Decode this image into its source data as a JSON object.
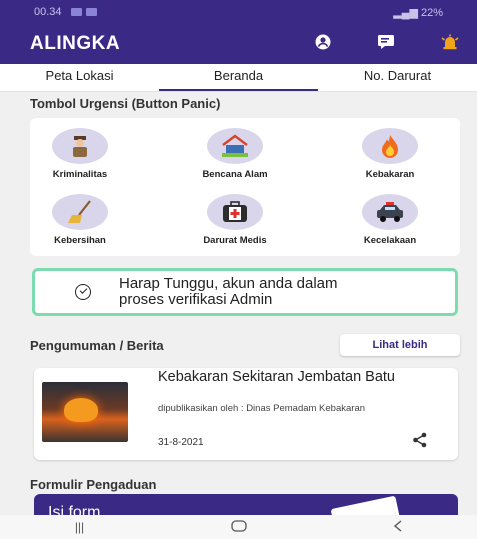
{
  "status_bar": {
    "time": "00.34",
    "battery": "22%"
  },
  "app": {
    "title": "ALINGKA"
  },
  "tabs": [
    {
      "label": "Peta Lokasi"
    },
    {
      "label": "Beranda"
    },
    {
      "label": "No. Darurat"
    }
  ],
  "active_tab": "Beranda",
  "panic": {
    "title": "Tombol Urgensi (Button Panic)",
    "items": [
      {
        "label": "Kriminalitas",
        "icon": "police-officer-icon"
      },
      {
        "label": "Bencana Alam",
        "icon": "disaster-house-icon"
      },
      {
        "label": "Kebakaran",
        "icon": "fire-icon"
      },
      {
        "label": "Kebersihan",
        "icon": "broom-icon"
      },
      {
        "label": "Darurat Medis",
        "icon": "medical-kit-icon"
      },
      {
        "label": "Kecelakaan",
        "icon": "police-car-icon"
      }
    ]
  },
  "verification": {
    "message_line1": "Harap Tunggu, akun anda dalam",
    "message_line2": "proses verifikasi Admin"
  },
  "news": {
    "section_title": "Pengumuman / Berita",
    "more_label": "Lihat lebih",
    "item": {
      "title": "Kebakaran Sekitaran Jembatan Batu",
      "published_by": "dipublikasikan oleh : Dinas Pemadam Kebakaran",
      "date": "31-8-2021"
    }
  },
  "form": {
    "section_title": "Formulir Pengaduan",
    "card_label": "Isi form"
  },
  "colors": {
    "primary": "#3a2a86",
    "verify_border": "#7ddbb0",
    "icon_bg": "#d9d6ec"
  }
}
